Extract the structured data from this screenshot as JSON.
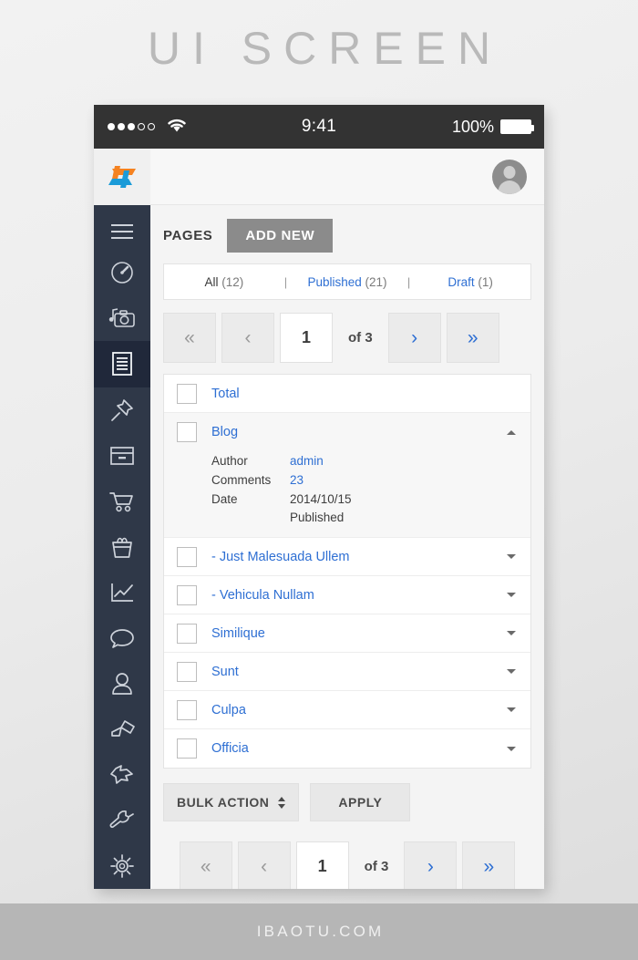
{
  "poster": {
    "title": "UI SCREEN",
    "footer": "IBAOTU.COM"
  },
  "statusbar": {
    "signal_filled": 3,
    "signal_hollow": 2,
    "wifi_icon": "wifi-icon",
    "time": "9:41",
    "battery_percent": "100%",
    "battery_icon": "battery-full-icon"
  },
  "topbar": {
    "logo_icon": "brand-logo-icon",
    "avatar_icon": "user-avatar-icon"
  },
  "sidebar": {
    "items": [
      {
        "id": "menu",
        "icon": "hamburger-menu-icon",
        "active": false
      },
      {
        "id": "dashboard",
        "icon": "speedometer-icon",
        "active": false
      },
      {
        "id": "media",
        "icon": "camera-media-icon",
        "active": false
      },
      {
        "id": "pages",
        "icon": "document-lines-icon",
        "active": true
      },
      {
        "id": "pinned",
        "icon": "pushpin-icon",
        "active": false
      },
      {
        "id": "archive",
        "icon": "archive-box-icon",
        "active": false
      },
      {
        "id": "shop",
        "icon": "shopping-cart-icon",
        "active": false
      },
      {
        "id": "gifts",
        "icon": "gift-basket-icon",
        "active": false
      },
      {
        "id": "stats",
        "icon": "line-chart-icon",
        "active": false
      },
      {
        "id": "comments",
        "icon": "speech-bubble-icon",
        "active": false
      },
      {
        "id": "users",
        "icon": "user-icon",
        "active": false
      },
      {
        "id": "appearance",
        "icon": "paint-brush-icon",
        "active": false
      },
      {
        "id": "plugins",
        "icon": "plug-icon",
        "active": false
      },
      {
        "id": "tools",
        "icon": "wrench-icon",
        "active": false
      },
      {
        "id": "settings",
        "icon": "gear-icon",
        "active": false
      }
    ]
  },
  "main": {
    "section_label": "PAGES",
    "add_new_label": "ADD NEW",
    "tabs": [
      {
        "name": "All",
        "count": "(12)",
        "active": true
      },
      {
        "name": "Published",
        "count": "(21)",
        "active": false
      },
      {
        "name": "Draft",
        "count": "(1)",
        "active": false
      }
    ],
    "tab_separator": "|",
    "pagination": {
      "first_label": "«",
      "prev_label": "‹",
      "current_page": "1",
      "of_label": "of 3",
      "next_label": "›",
      "last_label": "»"
    },
    "list": {
      "total_row": {
        "label": "Total"
      },
      "group": {
        "label": "Blog",
        "caret": "collapse-caret-up-icon",
        "details": [
          {
            "key": "Author",
            "value": "admin",
            "link": true
          },
          {
            "key": "Comments",
            "value": "23",
            "link": true
          },
          {
            "key": "Date",
            "value": "2014/10/15",
            "link": false
          }
        ],
        "status": "Published"
      },
      "rows": [
        {
          "label": "- Just Malesuada Ullem"
        },
        {
          "label": "- Vehicula Nullam"
        },
        {
          "label": "Similique"
        },
        {
          "label": "Sunt"
        },
        {
          "label": "Culpa"
        },
        {
          "label": "Officia"
        }
      ]
    },
    "bulk": {
      "action_label": "BULK ACTION",
      "apply_label": "APPLY"
    }
  },
  "colors": {
    "sidebar_bg": "#2f3848",
    "sidebar_active": "#20283a",
    "link_blue": "#2e6fd3",
    "statusbar_bg": "#333333",
    "add_new_bg": "#8b8b8b",
    "logo_orange": "#f58220",
    "logo_blue": "#1b9bd8"
  }
}
